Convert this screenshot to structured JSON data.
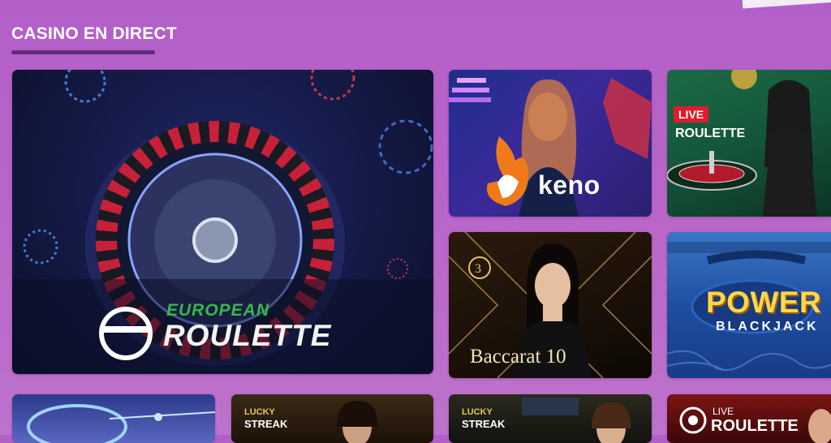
{
  "section": {
    "title": "CASINO EN DIRECT"
  },
  "cards": {
    "european_roulette": {
      "subtitle": "EUROPEAN",
      "title": "ROULETTE"
    },
    "keno": {
      "title": "keno"
    },
    "live_roulette_1": {
      "badge": "LIVE",
      "title": "ROULETTE"
    },
    "baccarat": {
      "title": "Baccarat 10"
    },
    "power_blackjack": {
      "title": "POWER",
      "subtitle": "BLACKJACK"
    },
    "lucky_streak_1": {
      "line1": "LUCKY",
      "line2": "STREAK"
    },
    "lucky_streak_2": {
      "line1": "LUCKY",
      "line2": "STREAK"
    },
    "live_roulette_2": {
      "badge": "LIVE",
      "title": "ROULETTE"
    }
  },
  "colors": {
    "background": "#b865c8",
    "underline": "#5f2c7d",
    "roulette_green": "#35b84a",
    "live_red": "#e01b2b"
  },
  "icons": [
    "roulette-wheel-icon",
    "dragon-icon",
    "baccarat-logo-icon",
    "roulette-logo-icon"
  ]
}
